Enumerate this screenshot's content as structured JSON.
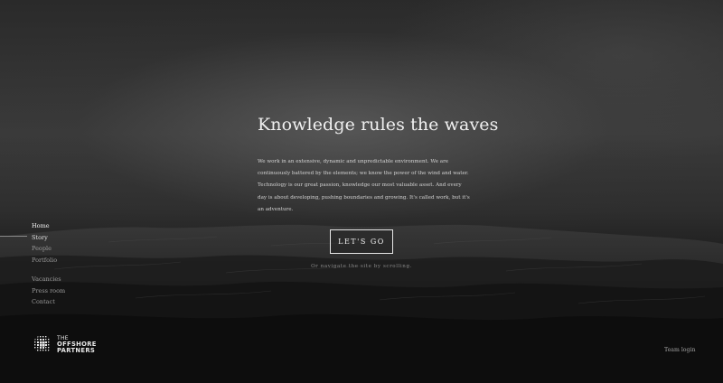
{
  "nav": {
    "primary": [
      {
        "label": "Home",
        "active": true
      },
      {
        "label": "Story",
        "current": true
      },
      {
        "label": "People"
      },
      {
        "label": "Portfolio"
      }
    ],
    "secondary": [
      {
        "label": "Vacancies"
      },
      {
        "label": "Press room"
      },
      {
        "label": "Contact"
      }
    ]
  },
  "hero": {
    "title": "Knowledge rules the waves",
    "body": "We work in an extensive, dynamic and unpredictable environment. We are continuously battered by the elements; we know the power of the wind and water. Technology is our great passion, knowledge our most valuable asset. And every day is about developing, pushing boundaries and growing. It's called work, but it's an adventure.",
    "cta_label": "LET'S GO",
    "scroll_hint": "Or navigate the site by scrolling."
  },
  "logo": {
    "line1": "THE",
    "line2": "OFFSHORE",
    "line3": "PARTNERS",
    "icon": "globe-grid-icon"
  },
  "footer": {
    "team_login": "Team login"
  },
  "colors": {
    "background": "#141414",
    "text_primary": "#f0f0f0",
    "text_muted": "#9a9a9a"
  }
}
